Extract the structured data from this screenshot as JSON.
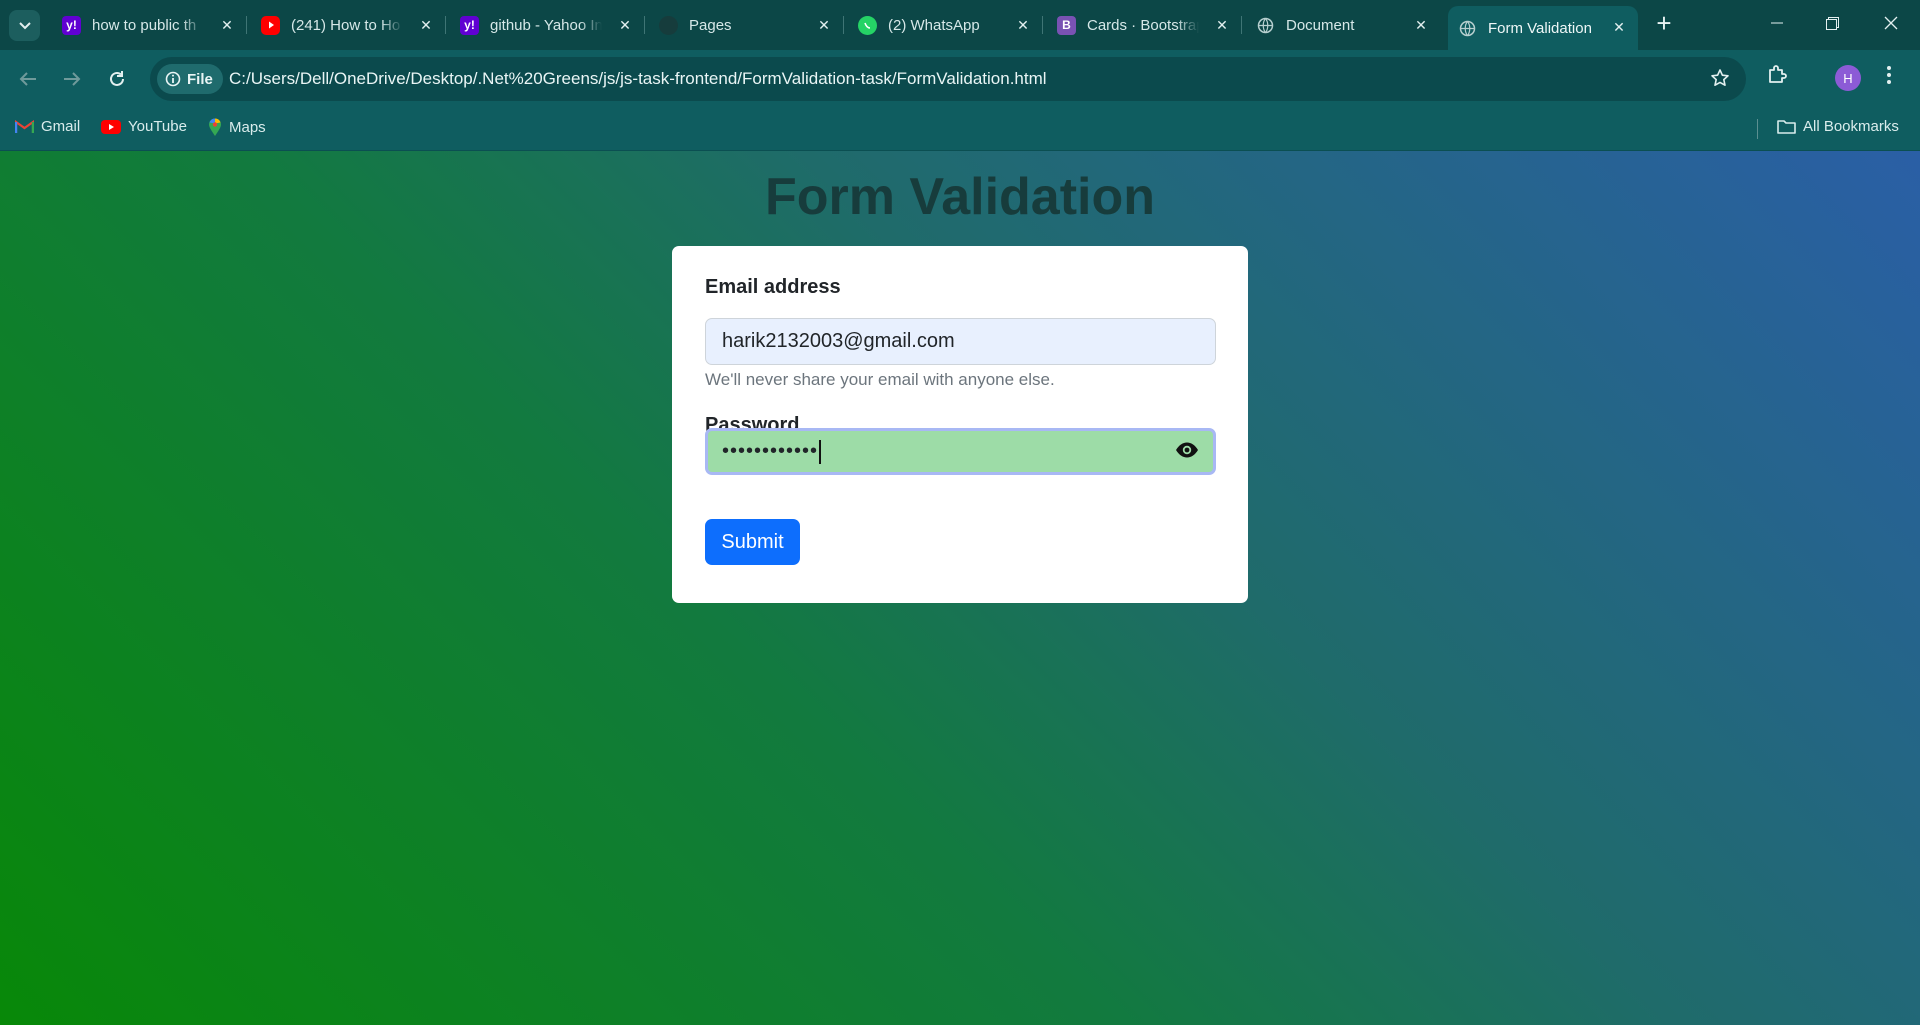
{
  "browser": {
    "tabs": [
      {
        "title": "how to public th",
        "icon": "yahoo-icon"
      },
      {
        "title": "(241) How to Ho",
        "icon": "youtube-icon"
      },
      {
        "title": "github - Yahoo In",
        "icon": "yahoo-icon"
      },
      {
        "title": "Pages",
        "icon": "github-icon"
      },
      {
        "title": "(2) WhatsApp",
        "icon": "whatsapp-icon"
      },
      {
        "title": "Cards · Bootstrap",
        "icon": "bootstrap-icon"
      },
      {
        "title": "Document",
        "icon": "globe-icon"
      },
      {
        "title": "Form Validation",
        "icon": "globe-icon",
        "active": true
      }
    ],
    "address": {
      "chip_label": "File",
      "url": "C:/Users/Dell/OneDrive/Desktop/.Net%20Greens/js/js-task-frontend/FormValidation-task/FormValidation.html"
    },
    "profile_initial": "H",
    "bookmarks": [
      {
        "label": "Gmail",
        "icon": "gmail-icon"
      },
      {
        "label": "YouTube",
        "icon": "youtube-icon"
      },
      {
        "label": "Maps",
        "icon": "maps-icon"
      }
    ],
    "all_bookmarks_label": "All Bookmarks"
  },
  "page": {
    "heading": "Form Validation",
    "form": {
      "email_label": "Email address",
      "email_value": "harik2132003@gmail.com",
      "email_help": "We'll never share your email with anyone else.",
      "password_label": "Password",
      "password_masked": "••••••••••••",
      "submit_label": "Submit"
    }
  },
  "colors": {
    "primary_button": "#0d6efd",
    "password_valid_bg": "#9ddca7",
    "email_autofill_bg": "#e8f0fe",
    "heading": "#173c3c",
    "browser_frame": "#0f5d60"
  }
}
